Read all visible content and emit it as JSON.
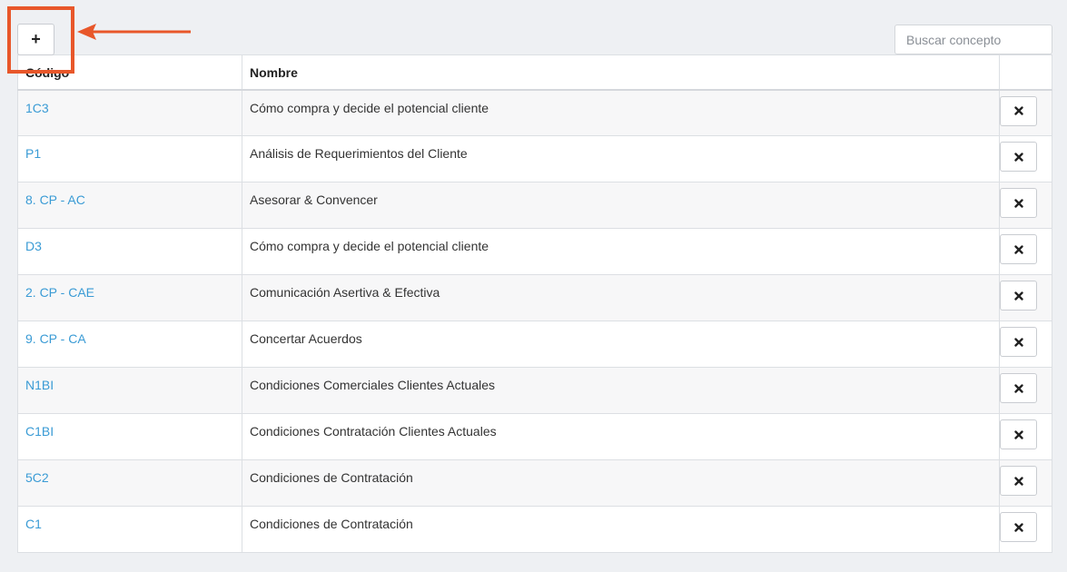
{
  "toolbar": {
    "add_label": "+",
    "search_placeholder": "Buscar concepto",
    "search_value": ""
  },
  "annotation": {
    "highlight_color": "#e8572a"
  },
  "table": {
    "columns": [
      "Código",
      "Nombre",
      ""
    ],
    "rows": [
      {
        "code": "1C3",
        "name": "Cómo compra y decide el potencial cliente"
      },
      {
        "code": "P1",
        "name": "Análisis de Requerimientos del Cliente"
      },
      {
        "code": "8. CP - AC",
        "name": "Asesorar & Convencer"
      },
      {
        "code": "D3",
        "name": "Cómo compra y decide el potencial cliente"
      },
      {
        "code": "2. CP - CAE",
        "name": "Comunicación Asertiva & Efectiva"
      },
      {
        "code": "9. CP - CA",
        "name": "Concertar Acuerdos"
      },
      {
        "code": "N1BI",
        "name": "Condiciones Comerciales Clientes Actuales"
      },
      {
        "code": "C1BI",
        "name": "Condiciones Contratación Clientes Actuales"
      },
      {
        "code": "5C2",
        "name": "Condiciones de Contratación"
      },
      {
        "code": "C1",
        "name": "Condiciones de Contratación"
      }
    ],
    "delete_icon": "close-icon"
  },
  "colors": {
    "link": "#3a9bd5",
    "background": "#eef0f3"
  }
}
